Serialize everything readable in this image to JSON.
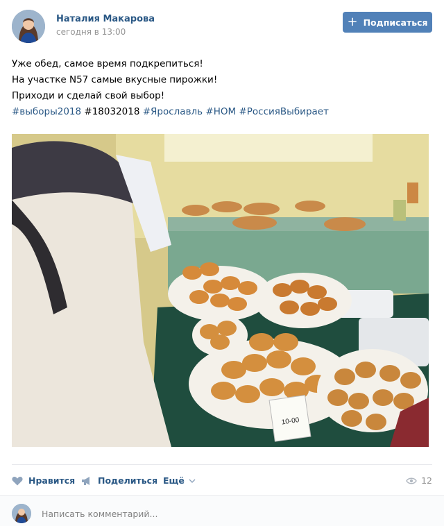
{
  "post": {
    "author": "Наталия Макарова",
    "time": "сегодня в 13:00",
    "subscribe_label": "Подписаться",
    "text_lines": [
      "Уже обед, самое время подкрепиться!",
      "На участке N57 самые вкусные пирожки!",
      "Приходи и сделай свой выбор!"
    ],
    "hashtags": [
      "#выборы2018",
      "#18032018",
      "#Ярославль",
      "#НОМ",
      "#РоссияВыбирает"
    ],
    "price_tag": "10-00"
  },
  "actions": {
    "like_label": "Нравится",
    "share_label": "Поделиться",
    "more_label": "Ещё",
    "views_count": "12"
  },
  "comment": {
    "placeholder": "Написать комментарий..."
  },
  "icons": [
    "plus-icon",
    "apple-icon",
    "heart-icon",
    "megaphone-icon",
    "chevron-down-icon",
    "eye-icon"
  ],
  "colors": {
    "link": "#2a5885",
    "button": "#5181b8",
    "meta": "#939393"
  }
}
